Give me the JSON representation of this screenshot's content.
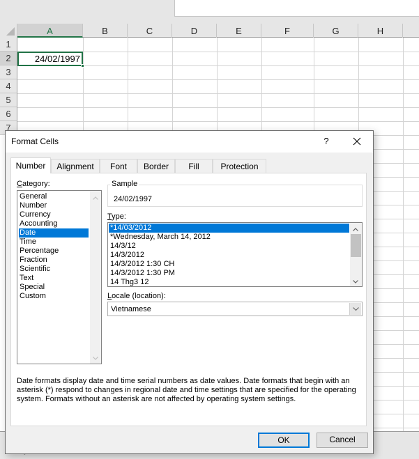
{
  "spreadsheet": {
    "columns": [
      "A",
      "B",
      "C",
      "D",
      "E",
      "F",
      "G",
      "H"
    ],
    "rows": [
      "1",
      "2",
      "3",
      "4",
      "5",
      "6",
      "7"
    ],
    "active_cell": "A2",
    "active_cell_value": "24/02/1997",
    "status_text": "Ready",
    "colors": {
      "accent": "#217346",
      "header_bg": "#e6e6e6",
      "gridline": "#d4d4d4"
    }
  },
  "dialog": {
    "title": "Format Cells",
    "help_label": "?",
    "tabs": [
      {
        "label": "Number",
        "active": true
      },
      {
        "label": "Alignment",
        "active": false
      },
      {
        "label": "Font",
        "active": false
      },
      {
        "label": "Border",
        "active": false
      },
      {
        "label": "Fill",
        "active": false
      },
      {
        "label": "Protection",
        "active": false
      }
    ],
    "category": {
      "label_accel": "C",
      "label_rest": "ategory:",
      "items": [
        "General",
        "Number",
        "Currency",
        "Accounting",
        "Date",
        "Time",
        "Percentage",
        "Fraction",
        "Scientific",
        "Text",
        "Special",
        "Custom"
      ],
      "selected": "Date"
    },
    "sample": {
      "label": "Sample",
      "value": "24/02/1997"
    },
    "type": {
      "label_accel": "T",
      "label_rest": "ype:",
      "items": [
        "*14/03/2012",
        "*Wednesday, March 14, 2012",
        "14/3/12",
        "14/3/2012",
        "14/3/2012 1:30 CH",
        "14/3/2012 1:30 PM",
        "14 Thg3 12"
      ],
      "selected": "*14/03/2012"
    },
    "locale": {
      "label_accel": "L",
      "label_rest": "ocale (location):",
      "value": "Vietnamese"
    },
    "description": "Date formats display date and time serial numbers as date values.  Date formats that begin with an asterisk (*) respond to changes in regional date and time settings that are specified for the operating system. Formats without an asterisk are not affected by operating system settings.",
    "ok_label": "OK",
    "cancel_label": "Cancel",
    "colors": {
      "selection": "#0078d7",
      "dialog_bg": "#f0f0f0"
    }
  }
}
